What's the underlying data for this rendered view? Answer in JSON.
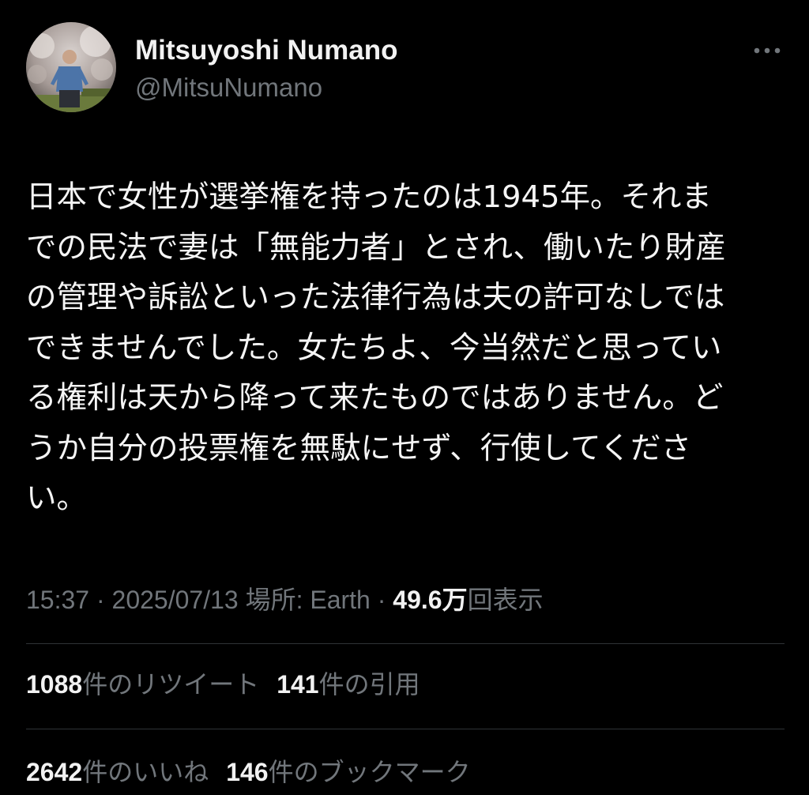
{
  "author": {
    "display_name": "Mitsuyoshi Numano",
    "handle": "@MitsuNumano"
  },
  "tweet": {
    "text": "日本で女性が選挙権を持ったのは1945年。それま\nでの民法で妻は「無能力者」とされ、働いたり財産\nの管理や訴訟といった法律行為は夫の許可なしでは\nできませんでした。女たちよ、今当然だと思ってい\nる権利は天から降って来たものではありません。ど\nうか自分の投票権を無駄にせず、行使してくださ\nい。"
  },
  "meta": {
    "time": "15:37",
    "separator": " · ",
    "date": "2025/07/13",
    "location": "場所: Earth",
    "views_count": "49.6万",
    "views_label": "回表示"
  },
  "stats": {
    "retweets_count": "1088",
    "retweets_label": "件のリツイート",
    "quotes_count": "141",
    "quotes_label": "件の引用",
    "likes_count": "2642",
    "likes_label": "件のいいね",
    "bookmarks_count": "146",
    "bookmarks_label": "件のブックマーク"
  },
  "icons": {
    "more": "more-horizontal-icon"
  },
  "colors": {
    "background": "#000000",
    "primary_text": "#e7e9ea",
    "secondary_text": "#71767b",
    "divider": "#2f3336"
  }
}
